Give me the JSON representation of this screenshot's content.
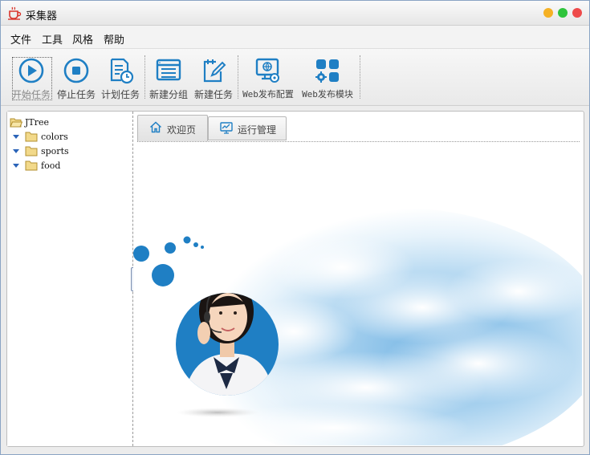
{
  "window": {
    "title": "采集器",
    "app_icon": "cup-icon",
    "controls": [
      "minimize",
      "maximize",
      "close"
    ]
  },
  "menu": [
    "文件",
    "工具",
    "风格",
    "帮助"
  ],
  "toolbar": [
    {
      "label": "开始任务",
      "icon": "play-icon"
    },
    {
      "label": "停止任务",
      "icon": "stop-icon"
    },
    {
      "label": "计划任务",
      "icon": "schedule-icon"
    },
    {
      "label": "新建分组",
      "icon": "new-group-icon"
    },
    {
      "label": "新建任务",
      "icon": "new-task-icon"
    },
    {
      "label": "Web发布配置",
      "icon": "web-config-icon"
    },
    {
      "label": "Web发布模块",
      "icon": "web-module-icon"
    }
  ],
  "tree": {
    "root": "JTree",
    "children": [
      "colors",
      "sports",
      "food"
    ]
  },
  "tabs": [
    {
      "label": "欢迎页",
      "icon": "home-icon",
      "selected": true
    },
    {
      "label": "运行管理",
      "icon": "monitor-chart-icon",
      "selected": false
    }
  ],
  "colors": {
    "accent": "#1f7fc4",
    "minimize": "#f5b124",
    "maximize": "#2ec43c",
    "close": "#ee4a4a"
  }
}
